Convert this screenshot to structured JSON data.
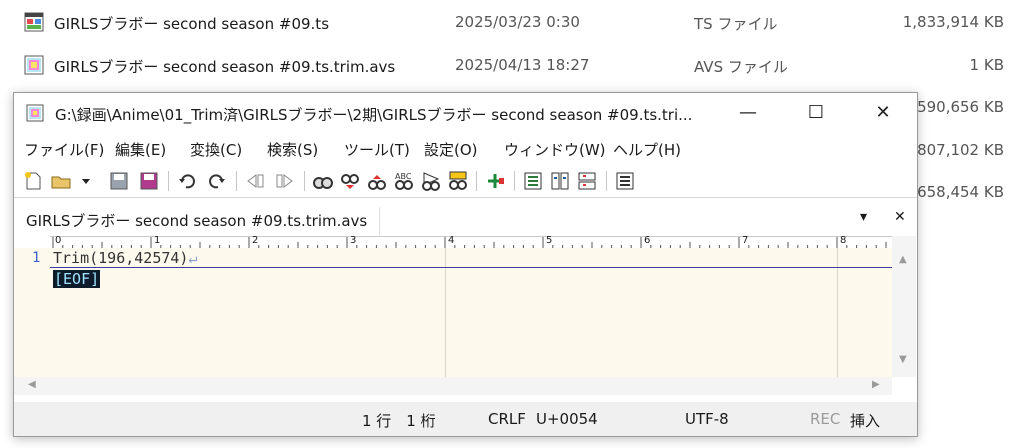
{
  "explorer": {
    "files": [
      {
        "name": "GIRLSブラボー second season #09.ts",
        "date": "2025/03/23 0:30",
        "type": "TS ファイル",
        "size": "1,833,914 KB",
        "icon": "video-file-icon"
      },
      {
        "name": "GIRLSブラボー second season #09.ts.trim.avs",
        "date": "2025/04/13 18:27",
        "type": "AVS ファイル",
        "size": "1 KB",
        "icon": "avs-file-icon"
      }
    ],
    "hidden_sizes": [
      "590,656 KB",
      "807,102 KB",
      "658,454 KB"
    ]
  },
  "editor": {
    "title": "G:\\録画\\Anime\\01_Trim済\\GIRLSブラボー\\2期\\GIRLSブラボー second season #09.ts.tri...",
    "menu": [
      "ファイル(F)",
      "編集(E)",
      "変換(C)",
      "検索(S)",
      "ツール(T)",
      "設定(O)",
      "ウィンドウ(W)",
      "ヘルプ(H)"
    ],
    "tab_label": "GIRLSブラボー second season #09.ts.trim.avs",
    "ruler_labels": [
      "0",
      "1",
      "2",
      "3",
      "4",
      "5",
      "6",
      "7",
      "8"
    ],
    "line_number": "1",
    "code_line": "Trim(196,42574)",
    "newline_mark": "↵",
    "eof_marker": "[EOF]",
    "status": {
      "position": "1 行　1 桁",
      "line_ending": "CRLF",
      "codepoint": "U+0054",
      "encoding": "UTF-8",
      "rec": "REC",
      "mode": "挿入"
    },
    "window_buttons": {
      "minimize": "—",
      "maximize": "☐",
      "close": "✕"
    },
    "tab_controls": {
      "dropdown": "▾",
      "close": "✕"
    }
  }
}
